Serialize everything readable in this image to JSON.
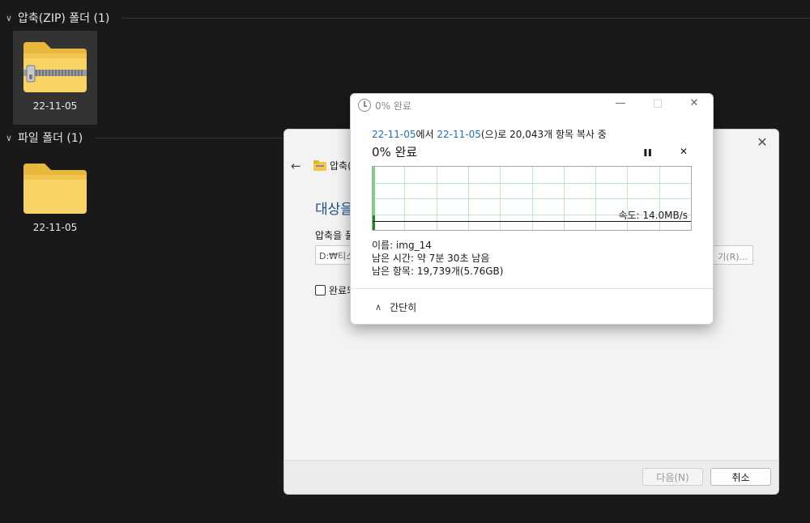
{
  "explorer": {
    "groups": [
      {
        "header": "압축(ZIP) 폴더 (1)",
        "items": [
          {
            "name": "22-11-05",
            "type": "zip-folder",
            "selected": true
          }
        ]
      },
      {
        "header": "파일 폴더 (1)",
        "items": [
          {
            "name": "22-11-05",
            "type": "folder",
            "selected": false
          }
        ]
      }
    ]
  },
  "wizard": {
    "breadcrumb": "압축(",
    "heading": "대상을",
    "field_label": "압축을 풀",
    "path_value": "D:₩티스",
    "browse_label": "기(R)...",
    "checkbox_label": "완료되",
    "next_label": "다음(N)",
    "cancel_label": "취소"
  },
  "copy_dialog": {
    "title": "0% 완료",
    "source": "22-11-05",
    "source_suffix": "에서",
    "dest": "22-11-05",
    "dest_suffix": "(으)로 20,043개 항목 복사 중",
    "percent_text": "0% 완료",
    "pause_symbol": "❚❚",
    "cancel_symbol": "✕",
    "speed": "속도: 14.0MB/s",
    "progress": 0.005,
    "name_line": "이름: img_14",
    "time_line": "남은 시간: 약 7분 30초 남음",
    "items_line": "남은 항목: 19,739개(5.76GB)",
    "less_details_label": "간단히"
  },
  "colors": {
    "link": "#1f6fbf",
    "graph_grid": "#bfe6c4",
    "graph_fill": "#7ed37e",
    "graph_bar": "#1c8a2b",
    "heading": "#1a4e8c"
  }
}
